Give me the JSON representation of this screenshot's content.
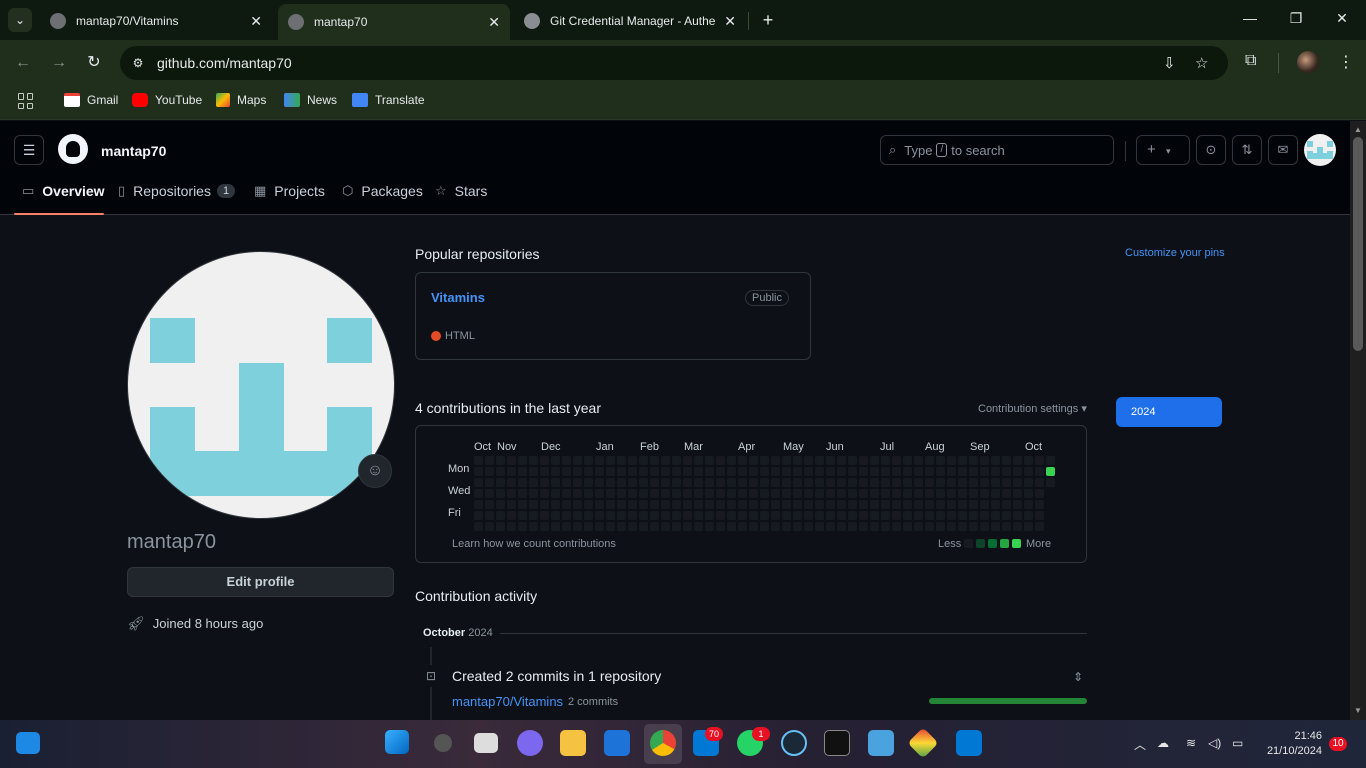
{
  "browser": {
    "tabs": [
      {
        "title": "mantap70/Vitamins"
      },
      {
        "title": "mantap70"
      },
      {
        "title": "Git Credential Manager - Authe"
      }
    ],
    "url": "github.com/mantap70",
    "bookmarks": [
      "Gmail",
      "YouTube",
      "Maps",
      "News",
      "Translate"
    ]
  },
  "github": {
    "username": "mantap70",
    "search_prefix": "Type",
    "search_key": "/",
    "search_suffix": "to search",
    "nav": {
      "overview": "Overview",
      "repositories": "Repositories",
      "repositories_count": "1",
      "projects": "Projects",
      "packages": "Packages",
      "stars": "Stars"
    },
    "profile": {
      "name": "mantap70",
      "edit_button": "Edit profile",
      "joined": "Joined 8 hours ago"
    },
    "popular": {
      "title": "Popular repositories",
      "customize": "Customize your pins",
      "repo_name": "Vitamins",
      "repo_visibility": "Public",
      "repo_language": "HTML",
      "language_color": "#e34c26"
    },
    "contributions": {
      "title": "4 contributions in the last year",
      "settings": "Contribution settings",
      "year": "2024",
      "months": [
        "Oct",
        "Nov",
        "Dec",
        "Jan",
        "Feb",
        "Mar",
        "Apr",
        "May",
        "Jun",
        "Jul",
        "Aug",
        "Sep",
        "Oct"
      ],
      "days": [
        "Mon",
        "Wed",
        "Fri"
      ],
      "learn": "Learn how we count contributions",
      "less": "Less",
      "more": "More",
      "legend_colors": [
        "#161b22",
        "#0e4429",
        "#006d32",
        "#26a641",
        "#39d353"
      ],
      "active_color": "#39d353"
    },
    "activity": {
      "title": "Contribution activity",
      "month": "October",
      "year": "2024",
      "item_title": "Created 2 commits in 1 repository",
      "repo": "mantap70/Vitamins",
      "commits": "2 commits"
    }
  },
  "taskbar": {
    "mail_badge": "70",
    "whatsapp_badge": "1",
    "time": "21:46",
    "date": "21/10/2024",
    "notifications": "10"
  }
}
